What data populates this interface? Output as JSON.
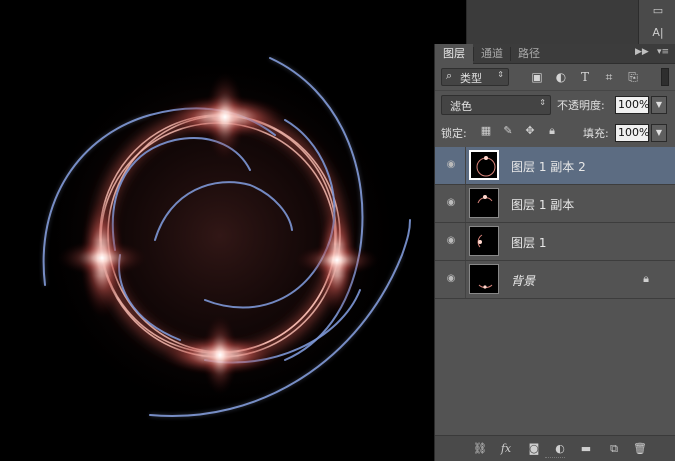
{
  "panel": {
    "tabs": [
      {
        "label": "图层",
        "active": true
      },
      {
        "label": "通道",
        "active": false
      },
      {
        "label": "路径",
        "active": false
      }
    ],
    "filter": {
      "kind_label": "类型",
      "icons": [
        "image-filter-icon",
        "adjustment-filter-icon",
        "type-filter-icon",
        "shape-filter-icon",
        "smart-object-filter-icon"
      ]
    },
    "blend_mode": "滤色",
    "opacity_label": "不透明度:",
    "opacity_value": "100%",
    "lock_label": "锁定:",
    "fill_label": "填充:",
    "fill_value": "100%",
    "layers": [
      {
        "name": "图层 1 副本 2",
        "selected": true,
        "visible": true
      },
      {
        "name": "图层 1 副本",
        "selected": false,
        "visible": true
      },
      {
        "name": "图层 1",
        "selected": false,
        "visible": true
      },
      {
        "name": "背景",
        "selected": false,
        "visible": true,
        "locked": true
      }
    ]
  },
  "colors": {
    "selection": "#5c6c82",
    "panel_bg": "#535353",
    "glow": "#ff9a8a",
    "arc_blue": "#6a86c9"
  }
}
